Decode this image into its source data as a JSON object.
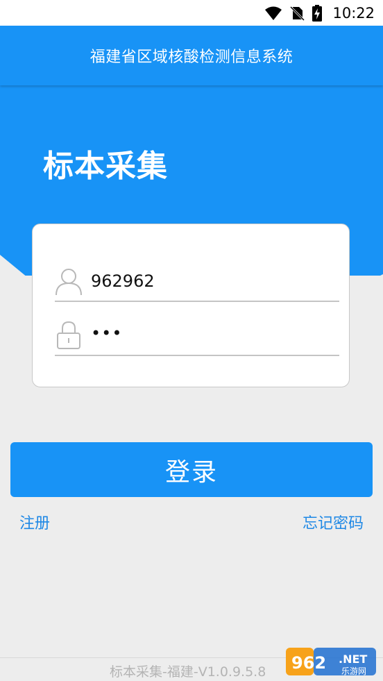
{
  "status_bar": {
    "time": "10:22"
  },
  "header": {
    "title": "福建省区域核酸检测信息系统"
  },
  "hero": {
    "title": "标本采集"
  },
  "login_form": {
    "username_value": "962962",
    "password_masked": "•••"
  },
  "actions": {
    "login_label": "登录",
    "register_label": "注册",
    "forgot_label": "忘记密码"
  },
  "footer": {
    "version": "标本采集-福建-V1.0.9.5.8"
  },
  "watermark": {
    "logo_text": "962.NET",
    "site_text": "乐游网"
  },
  "colors": {
    "primary": "#1893f6",
    "link": "#1e88e5",
    "background": "#ededed"
  }
}
